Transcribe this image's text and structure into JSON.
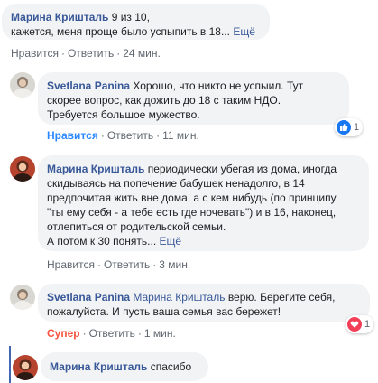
{
  "comments": [
    {
      "author": "Марина Кришталь",
      "text_line1": " 9 из 10,",
      "text_line2": "кажется, меня проще было успыпить в 18... ",
      "more": "Ещё",
      "actions": {
        "like": "Нравится",
        "reply": "Ответить",
        "time": "24 мин."
      }
    },
    {
      "author": "Svetlana Panina",
      "text_line1": " Хорошо, что никто не успыил. Тут",
      "text_line2": "скорее вопрос, как дожить до 18 с таким НДО.",
      "text_line3": "Требуется большое мужество.",
      "reaction_count": "1",
      "actions": {
        "like": "Нравится",
        "reply": "Ответить",
        "time": "11 мин."
      }
    },
    {
      "author": "Марина Кришталь",
      "text_line1": " периодически убегая из дома, иногда",
      "text_line2": "скидываясь на попечение бабушек ненадолго, в 14",
      "text_line3": "предпочитая жить вне дома, а с кем нибудь (по принципу",
      "text_line4": "\"ты ему себя - а тебе есть где ночевать\") и в 16, наконец,",
      "text_line5": "отлепиться от родительской семьи.",
      "text_line6": "А потом к 30 понять... ",
      "more": "Ещё",
      "actions": {
        "like": "Нравится",
        "reply": "Ответить",
        "time": "3 мин."
      }
    },
    {
      "author": "Svetlana Panina",
      "mention": " Марина Кришталь",
      "text_line1": " верю. Берегите себя,",
      "text_line2": "пожалуйста. И пусть ваша семья вас бережет!",
      "reaction_count": "1",
      "actions": {
        "like": "Супер",
        "reply": "Ответить",
        "time": "1 мин."
      }
    },
    {
      "author": "Марина Кришталь",
      "text_line1": " спасибо"
    }
  ],
  "colors": {
    "link": "#385898",
    "like_active": "#2d88ff",
    "super": "#f7533f",
    "bubble_bg": "#f2f3f5",
    "meta": "#606770",
    "thread_line": "#4267b2"
  },
  "icons": [
    "thumbs-up-icon",
    "heart-icon"
  ]
}
